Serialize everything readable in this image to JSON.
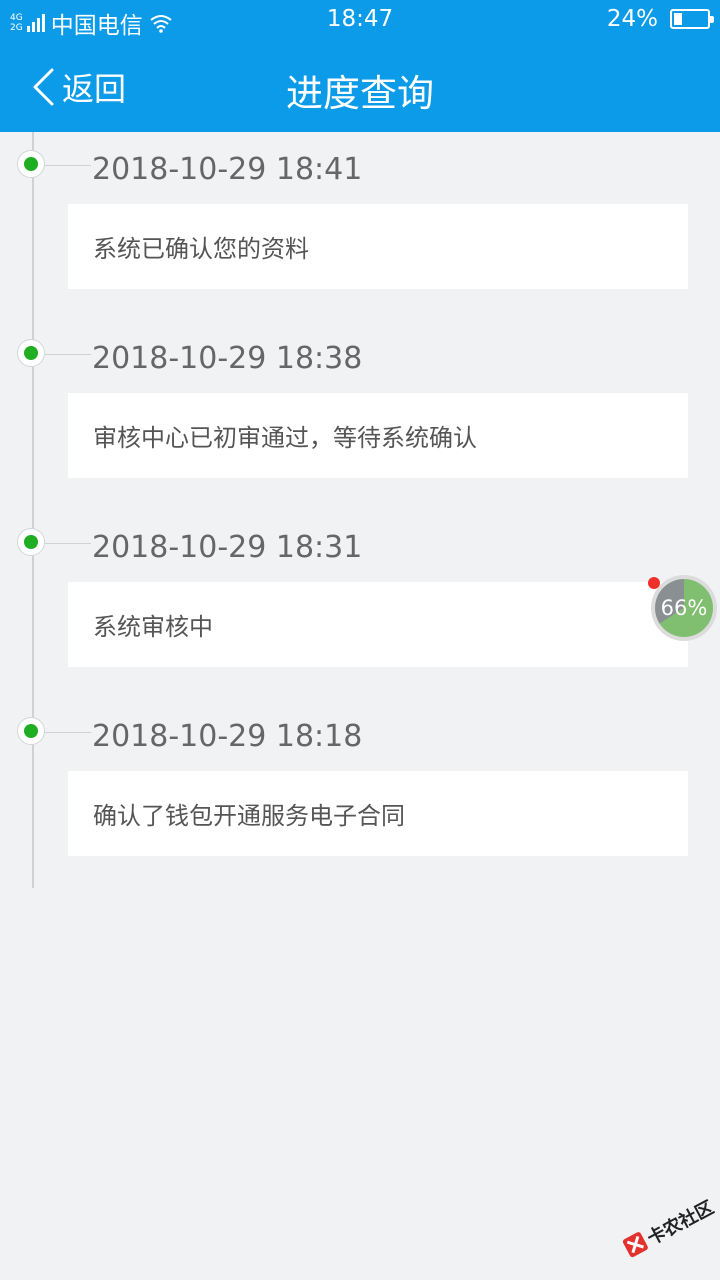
{
  "status_bar": {
    "network_top": "4G",
    "network_bottom": "2G",
    "carrier": "中国电信",
    "time": "18:47",
    "battery": "24%",
    "battery_level": 0.24
  },
  "nav": {
    "back_label": "返回",
    "title": "进度查询"
  },
  "timeline": [
    {
      "date": "2018-10-29 18:41",
      "text": "系统已确认您的资料"
    },
    {
      "date": "2018-10-29 18:38",
      "text": "审核中心已初审通过，等待系统确认"
    },
    {
      "date": "2018-10-29 18:31",
      "text": "系统审核中"
    },
    {
      "date": "2018-10-29 18:18",
      "text": "确认了钱包开通服务电子合同"
    }
  ],
  "float_ball": {
    "label": "66%",
    "level": 0.66
  },
  "watermark": {
    "text": "卡农社区"
  },
  "colors": {
    "brand": "#0c9be8",
    "background": "#f1f2f4",
    "dot": "#1fae21",
    "badge": "#f0312a"
  }
}
